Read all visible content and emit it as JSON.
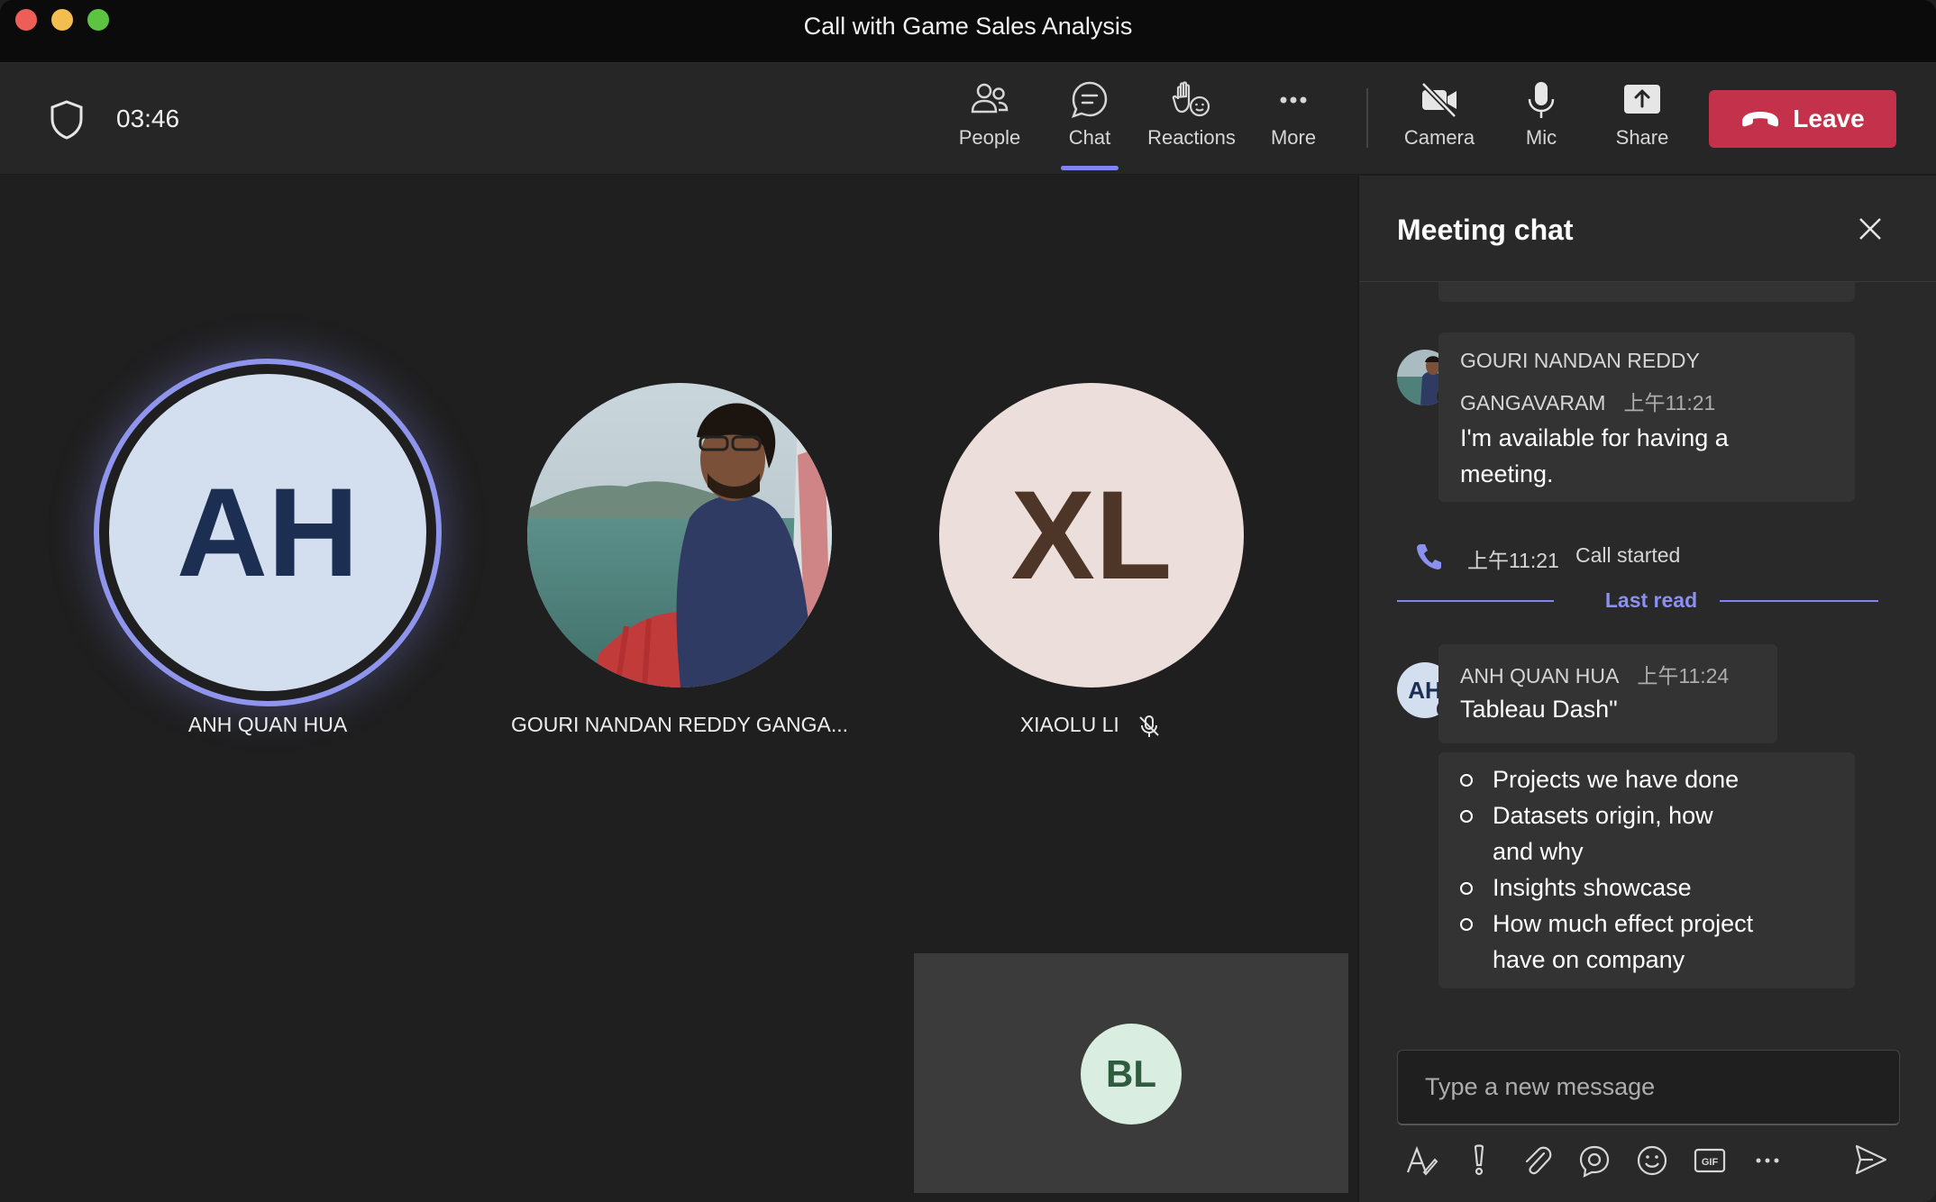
{
  "window": {
    "title": "Call with Game Sales Analysis"
  },
  "toolbar": {
    "timer": "03:46",
    "buttons": {
      "people": "People",
      "chat": "Chat",
      "reactions": "Reactions",
      "more": "More",
      "camera": "Camera",
      "mic": "Mic",
      "share": "Share"
    },
    "leave_label": "Leave",
    "leave_color": "#c4314b",
    "active_tab": "Chat",
    "accent_color": "#7f85f5"
  },
  "stage": {
    "participants": [
      {
        "initials": "AH",
        "name": "ANH QUAN HUA",
        "speaking": true
      },
      {
        "initials": "",
        "name": "GOURI NANDAN REDDY GANGA...",
        "photo": true
      },
      {
        "initials": "XL",
        "name": "XIAOLU LI",
        "muted": true
      }
    ],
    "self_view": {
      "initials": "BL"
    }
  },
  "chat": {
    "title": "Meeting chat",
    "messages": [
      {
        "sender_line1": "GOURI NANDAN REDDY",
        "sender_line2": "GANGAVARAM",
        "time": "上午11:21",
        "text_line1": "I'm available for having a",
        "text_line2": "meeting."
      },
      {
        "sender": "ANH QUAN HUA",
        "avatar_initials": "AH",
        "time": "上午11:24",
        "text": "Tableau Dash\"",
        "bullets": [
          "Projects we have done",
          "Datasets origin, how and why",
          "Insights showcase",
          "How much effect project have on company"
        ]
      }
    ],
    "call_event": {
      "time": "上午11:21",
      "text": "Call started"
    },
    "last_read_label": "Last read",
    "composer": {
      "placeholder": "Type a new message",
      "value": ""
    },
    "tools": [
      "format-icon",
      "important-icon",
      "attach-icon",
      "loop-icon",
      "emoji-icon",
      "gif-icon",
      "more-options-icon",
      "send-icon"
    ]
  }
}
